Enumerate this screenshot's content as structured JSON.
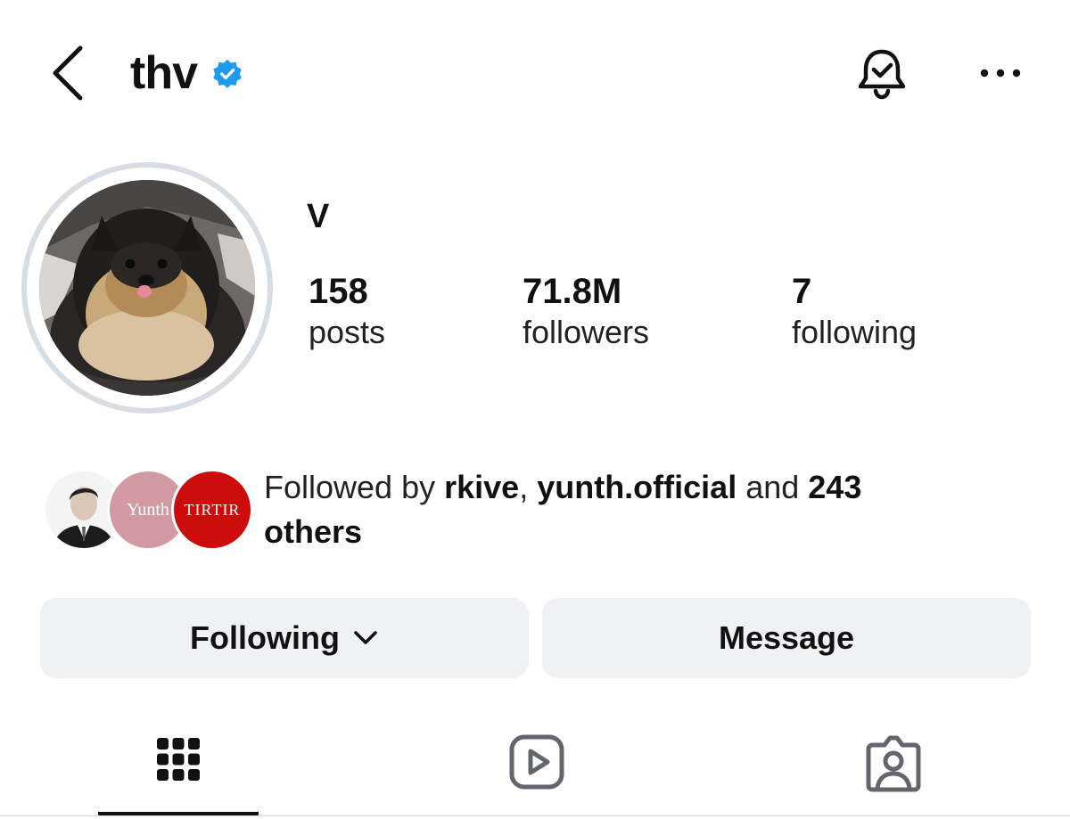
{
  "header": {
    "username": "thv",
    "verified": true,
    "icons": [
      "back-chevron-icon",
      "verified-badge-icon",
      "notification-bell-icon",
      "more-options-icon"
    ]
  },
  "profile": {
    "display_name": "V",
    "stats": {
      "posts_count": "158",
      "posts_label": "posts",
      "followers_count": "71.8M",
      "followers_label": "followers",
      "following_count": "7",
      "following_label": "following"
    }
  },
  "followed_by": {
    "prefix": "Followed by ",
    "user1": "rkive",
    "sep": ", ",
    "user2": "yunth.official",
    "and": " and ",
    "count": "243",
    "space": " ",
    "suffix": "others",
    "mutual_logos": {
      "yunth": "Yunth",
      "tirtir": "TIRTIR"
    }
  },
  "actions": {
    "following_label": "Following",
    "message_label": "Message"
  },
  "tabs": [
    {
      "name": "posts-grid",
      "icon": "grid-icon",
      "active": true
    },
    {
      "name": "reels",
      "icon": "reels-icon",
      "active": false
    },
    {
      "name": "tagged",
      "icon": "tagged-person-icon",
      "active": false
    }
  ],
  "colors": {
    "verified_blue": "#1d9bf0",
    "button_bg": "#eff1f4",
    "avatar_ring": "#d8dde3",
    "yunth_pink": "#d19aa2",
    "tirtir_red": "#cc0b0b"
  }
}
